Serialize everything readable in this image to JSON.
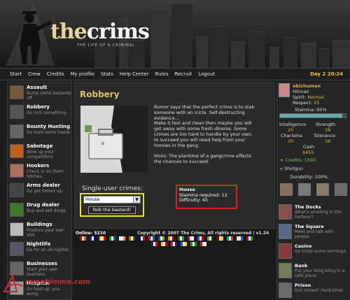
{
  "brand": {
    "the": "the",
    "crims": "crims",
    "tagline": "THE LIFE OF A CRIMINAL"
  },
  "nav": {
    "items": [
      "Start",
      "Crew",
      "Credits",
      "My profile",
      "Stats",
      "Help Center",
      "Rules",
      "Recruit",
      "Logout"
    ],
    "time": "Day 2 20:24"
  },
  "left_menu": [
    {
      "title": "Assault",
      "desc": "Bump some bastards off"
    },
    {
      "title": "Robbery",
      "desc": "Go nick something."
    },
    {
      "title": "Bounty Hunting",
      "desc": "Go hunt some heads"
    },
    {
      "title": "Sabotage",
      "desc": "Blow up your competitors!"
    },
    {
      "title": "Hookers",
      "desc": "Check in on them bitches."
    },
    {
      "title": "Arms dealer",
      "desc": "Go get tooled up."
    },
    {
      "title": "Drug dealer",
      "desc": "Buy and sell drugs."
    },
    {
      "title": "Buildings",
      "desc": "Produce your own shit."
    },
    {
      "title": "Nightlife",
      "desc": "Go for an all-nighter."
    },
    {
      "title": "Businesses",
      "desc": "Start your own business."
    },
    {
      "title": "Hospital",
      "desc": "Go heal up, you wimp."
    }
  ],
  "main": {
    "title": "Robbery",
    "description_lines": [
      "Rumor says that the perfect crime is to stab",
      "someone with an icicle. Self-destructing",
      "evidence...",
      "Make it fast and clean then maybe you will",
      "get away with some fresh dineros. Some",
      "crimes are too hard to handle by your own,",
      "to succeed you will need help from your",
      "homies in the gang.",
      "",
      "Hints: The plantime of a gangcrime effects",
      "the chances to succeed."
    ],
    "single_label": "Single-user crimes:",
    "select_value": "House",
    "rob_button": "Rob the bastard!",
    "info": {
      "title": "House",
      "stamina": "Stamina required: 12",
      "difficulty": "Difficulty: 45"
    }
  },
  "footer": {
    "online": "Online: 5210",
    "copyright": "Copyright © 2007 The Crims, All rights reserved | v1.24"
  },
  "player": {
    "name": "ebichuman",
    "rank": "Hitman",
    "spirit_label": "Spirit:",
    "spirit_value": "Normal",
    "respect_label": "Respect:",
    "respect_value": "25",
    "stamina_label": "Stamina:",
    "stamina_value": "95%",
    "stamina_pct": 95,
    "intelligence_label": "Intelligence",
    "intelligence_value": "20",
    "strength_label": "Strength",
    "strength_value": "38",
    "charisma_label": "Charisma",
    "charisma_value": "20",
    "tolerance_label": "Tolerance",
    "tolerance_value": "38",
    "cash_label": "Cash",
    "cash_value": "$455",
    "credits": "Credits: 1590",
    "weapon": "Shotgun",
    "durability": "Durability: 100%"
  },
  "right_menu": [
    {
      "title": "The Docks",
      "desc": "What's smelling in the harbour?"
    },
    {
      "title": "The Square",
      "desc": "Meet and talk with people."
    },
    {
      "title": "Casino",
      "desc": "Go triple some winnings."
    },
    {
      "title": "Bank",
      "desc": "Put your bling bling in a safe place."
    },
    {
      "title": "Prison",
      "desc": "Got nicked? Hard-time!"
    }
  ],
  "watermark": "mmohimmo.com",
  "colors": {
    "accent": "#e0c060",
    "yellow_box": "#e5e02a",
    "red_box": "#e02020"
  }
}
